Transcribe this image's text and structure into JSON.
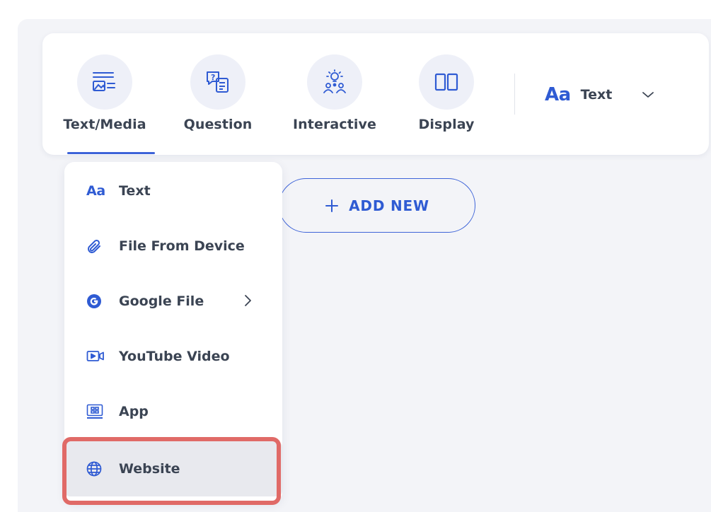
{
  "toolbar": {
    "tabs": [
      {
        "id": "text-media",
        "label": "Text/Media",
        "icon": "text-media-icon",
        "active": true
      },
      {
        "id": "question",
        "label": "Question",
        "icon": "question-icon",
        "active": false
      },
      {
        "id": "interactive",
        "label": "Interactive",
        "icon": "interactive-icon",
        "active": false
      },
      {
        "id": "display",
        "label": "Display",
        "icon": "display-columns-icon",
        "active": false
      }
    ],
    "format_select": {
      "glyph": "Aa",
      "label": "Text",
      "icon": "chevron-down-icon"
    }
  },
  "add_new": {
    "label": "ADD NEW",
    "icon": "plus-icon"
  },
  "menu": {
    "items": [
      {
        "label": "Text",
        "icon": "text-aa-icon",
        "glyph": "Aa"
      },
      {
        "label": "File From Device",
        "icon": "paperclip-icon"
      },
      {
        "label": "Google File",
        "icon": "google-icon",
        "has_submenu": true
      },
      {
        "label": "YouTube Video",
        "icon": "video-icon"
      },
      {
        "label": "App",
        "icon": "app-grid-icon"
      },
      {
        "label": "Website",
        "icon": "globe-icon",
        "selected": true
      }
    ]
  },
  "colors": {
    "accent": "#2f5bd3",
    "highlight": "#e06a67",
    "canvas": "#f3f4f8"
  }
}
